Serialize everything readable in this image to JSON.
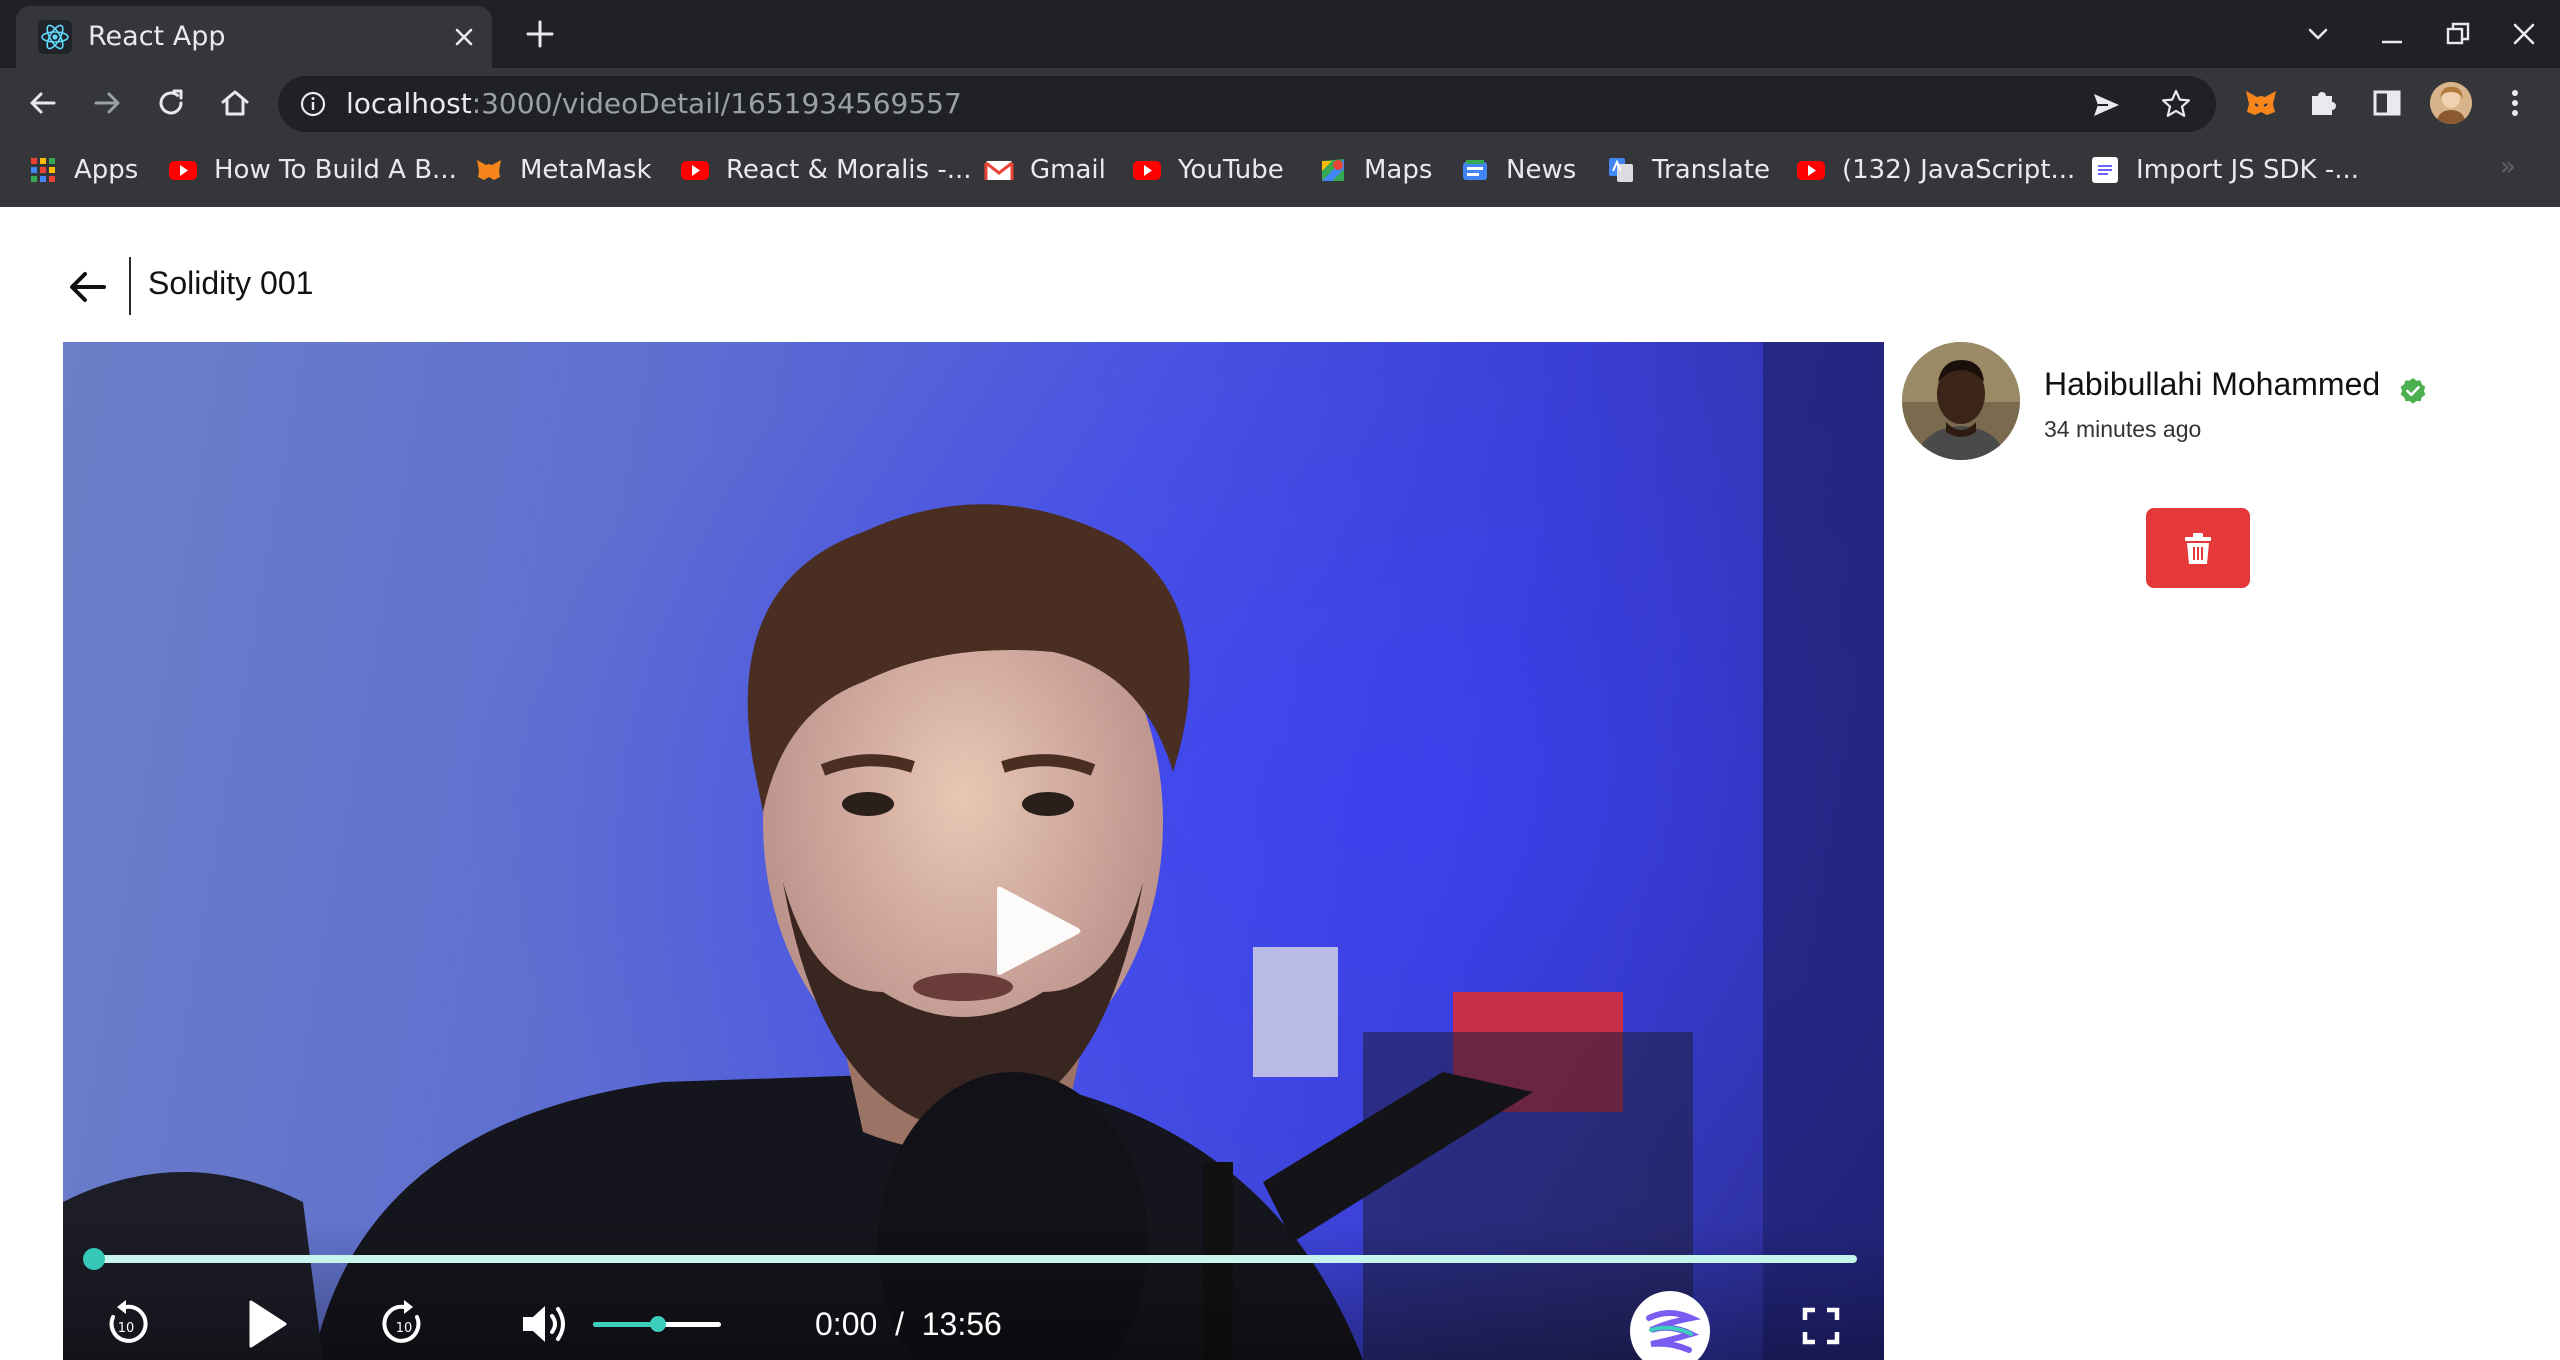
{
  "browser": {
    "tab": {
      "title": "React App",
      "favicon": "react-icon"
    },
    "window_controls": [
      "chevron-down-icon",
      "minimize-icon",
      "restore-icon",
      "close-icon"
    ],
    "address": {
      "host": "localhost",
      "path": ":3000/videoDetail/1651934569557"
    },
    "bookmarks": [
      {
        "label": "Apps",
        "icon": "apps-grid-icon"
      },
      {
        "label": "How To Build A B...",
        "icon": "youtube-icon"
      },
      {
        "label": "MetaMask",
        "icon": "metamask-icon"
      },
      {
        "label": "React & Moralis -...",
        "icon": "youtube-icon"
      },
      {
        "label": "Gmail",
        "icon": "gmail-icon"
      },
      {
        "label": "YouTube",
        "icon": "youtube-icon"
      },
      {
        "label": "Maps",
        "icon": "maps-icon"
      },
      {
        "label": "News",
        "icon": "news-icon"
      },
      {
        "label": "Translate",
        "icon": "translate-icon"
      },
      {
        "label": "(132) JavaScript...",
        "icon": "youtube-icon"
      },
      {
        "label": "Import JS SDK -...",
        "icon": "doc-icon"
      }
    ],
    "bookmarks_overflow": "»"
  },
  "page": {
    "title": "Solidity 001",
    "player": {
      "current_time": "0:00",
      "separator": "/",
      "duration": "13:56",
      "progress_fraction": 0,
      "volume_fraction": 0.5
    },
    "channel": {
      "name": "Habibullahi Mohammed",
      "posted": "34 minutes ago",
      "verified": true
    }
  },
  "colors": {
    "accent": "#3ccfbd",
    "delete": "#e5383b",
    "verified": "#4caf50",
    "chrome_dark": "#202124",
    "chrome_toolbar": "#35363a"
  }
}
